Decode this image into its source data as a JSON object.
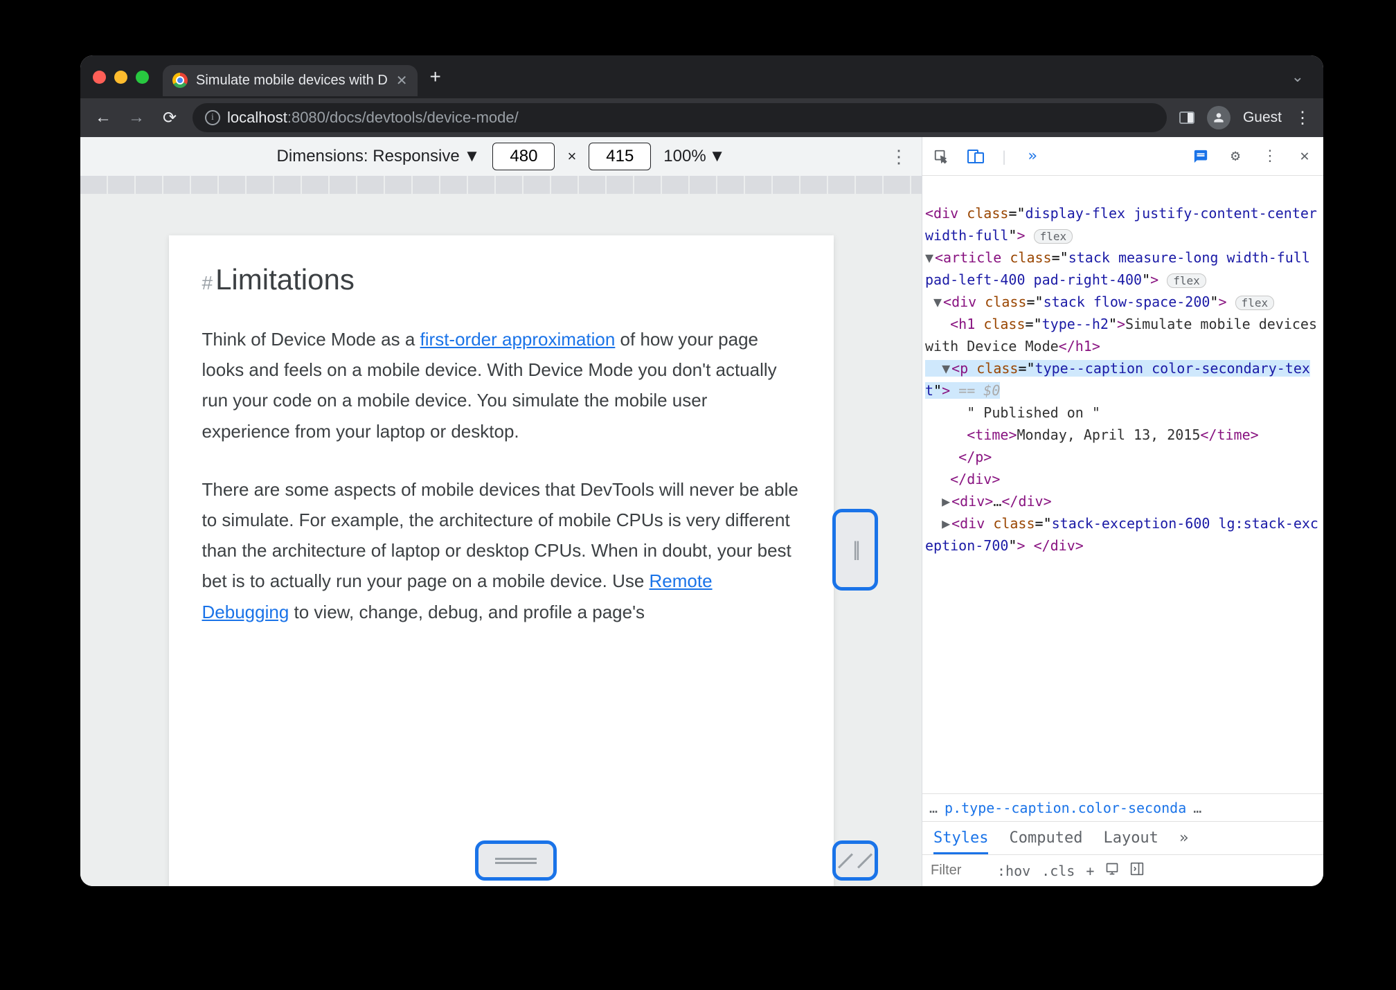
{
  "tab": {
    "title": "Simulate mobile devices with D"
  },
  "url": {
    "host": "localhost",
    "port": ":8080",
    "path": "/docs/devtools/device-mode/"
  },
  "profile": {
    "label": "Guest"
  },
  "deviceToolbar": {
    "dimensionsLabel": "Dimensions: Responsive",
    "width": "480",
    "height": "415",
    "zoom": "100%"
  },
  "article": {
    "heading": "Limitations",
    "hash": "#",
    "p1_a": "Think of Device Mode as a ",
    "p1_link": "first-order approximation",
    "p1_b": " of how your page looks and feels on a mobile device. With Device Mode you don't actually run your code on a mobile device. You simulate the mobile user experience from your laptop or desktop.",
    "p2_a": "There are some aspects of mobile devices that DevTools will never be able to simulate. For example, the architecture of mobile CPUs is very different than the architecture of laptop or desktop CPUs. When in doubt, your best bet is to actually run your page on a mobile device. Use ",
    "p2_link": "Remote Debugging",
    "p2_b": " to view, change, debug, and profile a page's"
  },
  "elements": {
    "badge": "flex",
    "line1a": "div",
    "line1_attr": "class",
    "line1_val": "display-flex justify-content-center width-full",
    "line2a": "article",
    "line2_val": "stack measure-long width-full pad-left-400 pad-right-400",
    "line3a": "div",
    "line3_val": "stack flow-space-200",
    "line4a": "h1",
    "line4_val": "type--h2",
    "line4_txt": "Simulate mobile devices with Device Mode",
    "line5a": "p",
    "line5_val": "type--caption color-secondary-text",
    "eq0": "== $0",
    "line6_txt": "\" Published on \"",
    "line7a": "time",
    "line7_txt": "Monday, April 13, 2015",
    "line8a": "div",
    "line8_txt": "…",
    "line9a": "div",
    "line9_val": "stack-exception-600 lg:stack-exception-700"
  },
  "breadcrumb": {
    "dots": "…",
    "path": "p.type--caption.color-seconda",
    "dots2": "…"
  },
  "stylesTabs": {
    "styles": "Styles",
    "computed": "Computed",
    "layout": "Layout"
  },
  "stylesFilter": {
    "placeholder": "Filter",
    "hov": ":hov",
    "cls": ".cls",
    "plus": "+"
  }
}
